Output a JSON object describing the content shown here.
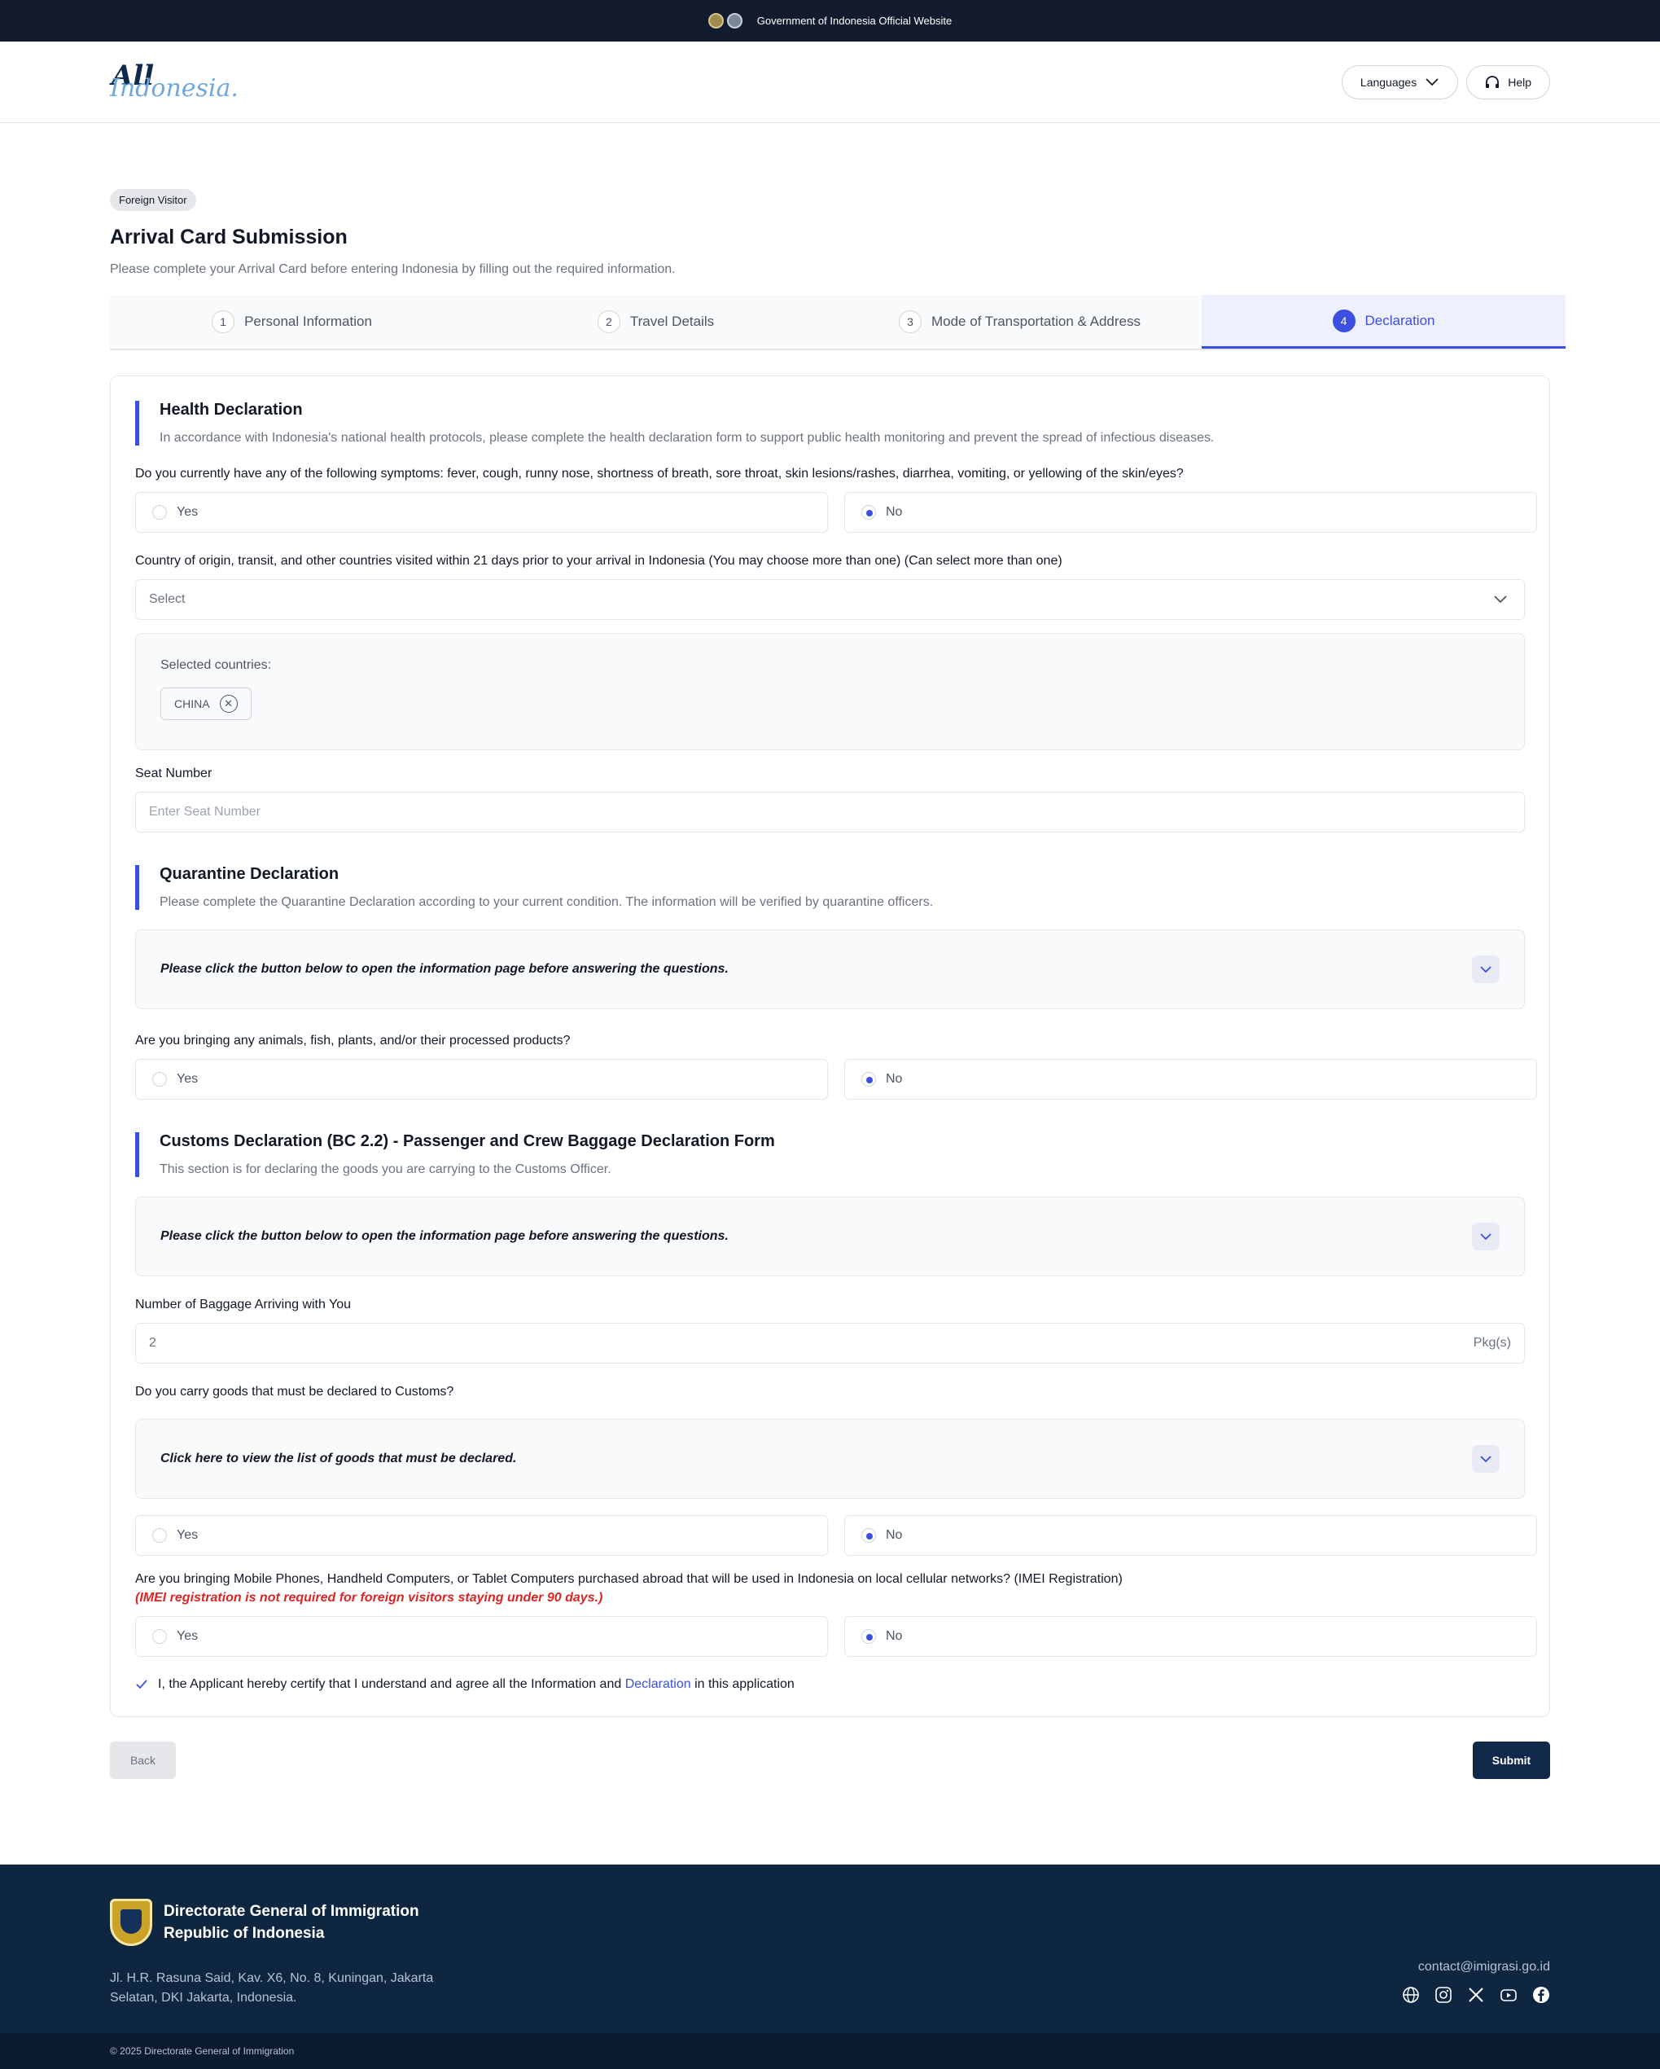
{
  "gov_bar": {
    "text": "Government of Indonesia Official Website"
  },
  "header": {
    "brand_top": "All",
    "brand_bottom": "Indonesia.",
    "languages_label": "Languages",
    "help_label": "Help"
  },
  "page": {
    "badge": "Foreign Visitor",
    "title": "Arrival Card Submission",
    "subtitle": "Please complete your Arrival Card before entering Indonesia by filling out the required information."
  },
  "tabs": [
    {
      "num": "1",
      "label": "Personal Information"
    },
    {
      "num": "2",
      "label": "Travel Details"
    },
    {
      "num": "3",
      "label": "Mode of Transportation & Address"
    },
    {
      "num": "4",
      "label": "Declaration"
    }
  ],
  "health": {
    "title": "Health Declaration",
    "desc": "In accordance with Indonesia's national health protocols, please complete the health declaration form to support public health monitoring and prevent the spread of infectious diseases.",
    "symptoms_q": "Do you currently have any of the following symptoms: fever, cough, runny nose, shortness of breath, sore throat, skin lesions/rashes, diarrhea, vomiting, or yellowing of the skin/eyes?",
    "countries_q": "Country of origin, transit, and other countries visited within 21 days prior to your arrival in Indonesia (You may choose more than one) (Can select more than one)",
    "select_placeholder": "Select",
    "selected_label": "Selected countries:",
    "selected_country": "CHINA",
    "seat_label": "Seat Number",
    "seat_placeholder": "Enter Seat Number"
  },
  "options": {
    "yes": "Yes",
    "no": "No"
  },
  "quarantine": {
    "title": "Quarantine Declaration",
    "desc": "Please complete the Quarantine Declaration according to your current condition. The information will be verified by quarantine officers.",
    "info": "Please click the button below to open the information page before answering the questions.",
    "animals_q": "Are you bringing any animals, fish, plants, and/or their processed products?"
  },
  "customs": {
    "title": "Customs Declaration (BC 2.2) - Passenger and Crew Baggage Declaration Form",
    "desc": "This section is for declaring the goods you are carrying to the Customs Officer.",
    "info": "Please click the button below to open the information page before answering the questions.",
    "baggage_label": "Number of Baggage Arriving with You",
    "baggage_value": "2",
    "baggage_unit": "Pkg(s)",
    "goods_q": "Do you carry goods that must be declared to Customs?",
    "goods_info": "Click here to view the list of goods that must be declared.",
    "imei_q": "Are you bringing Mobile Phones, Handheld Computers, or Tablet Computers purchased abroad that will be used in Indonesia on local cellular networks? (IMEI Registration)",
    "imei_note": "(IMEI registration is not required for foreign visitors staying under 90 days.)"
  },
  "agreement": {
    "before": "I, the Applicant hereby certify that I understand and agree all the Information and ",
    "link": "Declaration",
    "after": " in this application"
  },
  "actions": {
    "back": "Back",
    "submit": "Submit"
  },
  "footer": {
    "org_line1": "Directorate General of Immigration",
    "org_line2": "Republic of Indonesia",
    "address": "Jl. H.R. Rasuna Said, Kav. X6, No. 8, Kuningan, Jakarta Selatan, DKI Jakarta, Indonesia.",
    "email": "contact@imigrasi.go.id",
    "copyright": "© 2025 Directorate General of Immigration"
  }
}
